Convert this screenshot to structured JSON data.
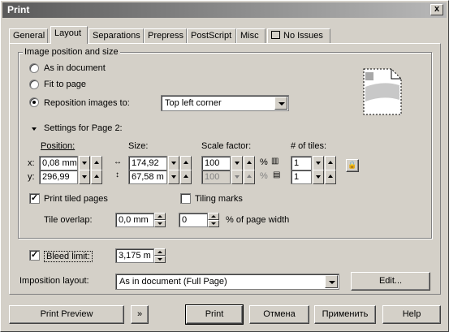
{
  "window": {
    "title": "Print",
    "close_glyph": "x"
  },
  "tabs": [
    {
      "label": "General",
      "active": false
    },
    {
      "label": "Layout",
      "active": true
    },
    {
      "label": "Separations",
      "active": false
    },
    {
      "label": "Prepress",
      "active": false
    },
    {
      "label": "PostScript",
      "active": false
    },
    {
      "label": "Misc",
      "active": false
    },
    {
      "label": "No Issues",
      "active": false,
      "icon": "issues-icon"
    }
  ],
  "image_position": {
    "group_label": "Image position and size",
    "options": [
      {
        "label": "As in document",
        "selected": false
      },
      {
        "label": "Fit to page",
        "selected": false
      },
      {
        "label": "Reposition images to:",
        "selected": true
      }
    ],
    "reposition_value": "Top left corner",
    "preview_icon": "page-preview-icon"
  },
  "settings": {
    "toggle_label": "Settings for Page 2:",
    "position_label": "Position:",
    "size_label": "Size:",
    "scale_label": "Scale factor:",
    "tiles_label": "# of tiles:",
    "x_label": "x:",
    "y_label": "y:",
    "pos_x": "0,08 mm",
    "pos_y": "296,99",
    "size_w": "174,92",
    "size_h": "67,58 m",
    "scale_x": "100",
    "scale_y": "100",
    "percent": "%",
    "tiles_x": "1",
    "tiles_y": "1",
    "lock_icon": "lock-icon"
  },
  "tiling": {
    "print_tiled_label": "Print tiled pages",
    "print_tiled_checked": true,
    "tiling_marks_label": "Tiling marks",
    "tiling_marks_checked": false,
    "overlap_label": "Tile overlap:",
    "overlap_value": "0,0 mm",
    "overlap_pct": "0",
    "overlap_pct_label": "% of page width"
  },
  "bleed": {
    "label": "Bleed limit:",
    "checked": true,
    "value": "3,175 m"
  },
  "imposition": {
    "label": "Imposition layout:",
    "value": "As in document (Full Page)",
    "edit_label": "Edit..."
  },
  "buttons": {
    "preview": "Print Preview",
    "expand": "»",
    "print": "Print",
    "cancel": "Отмена",
    "apply": "Применить",
    "help": "Help"
  }
}
